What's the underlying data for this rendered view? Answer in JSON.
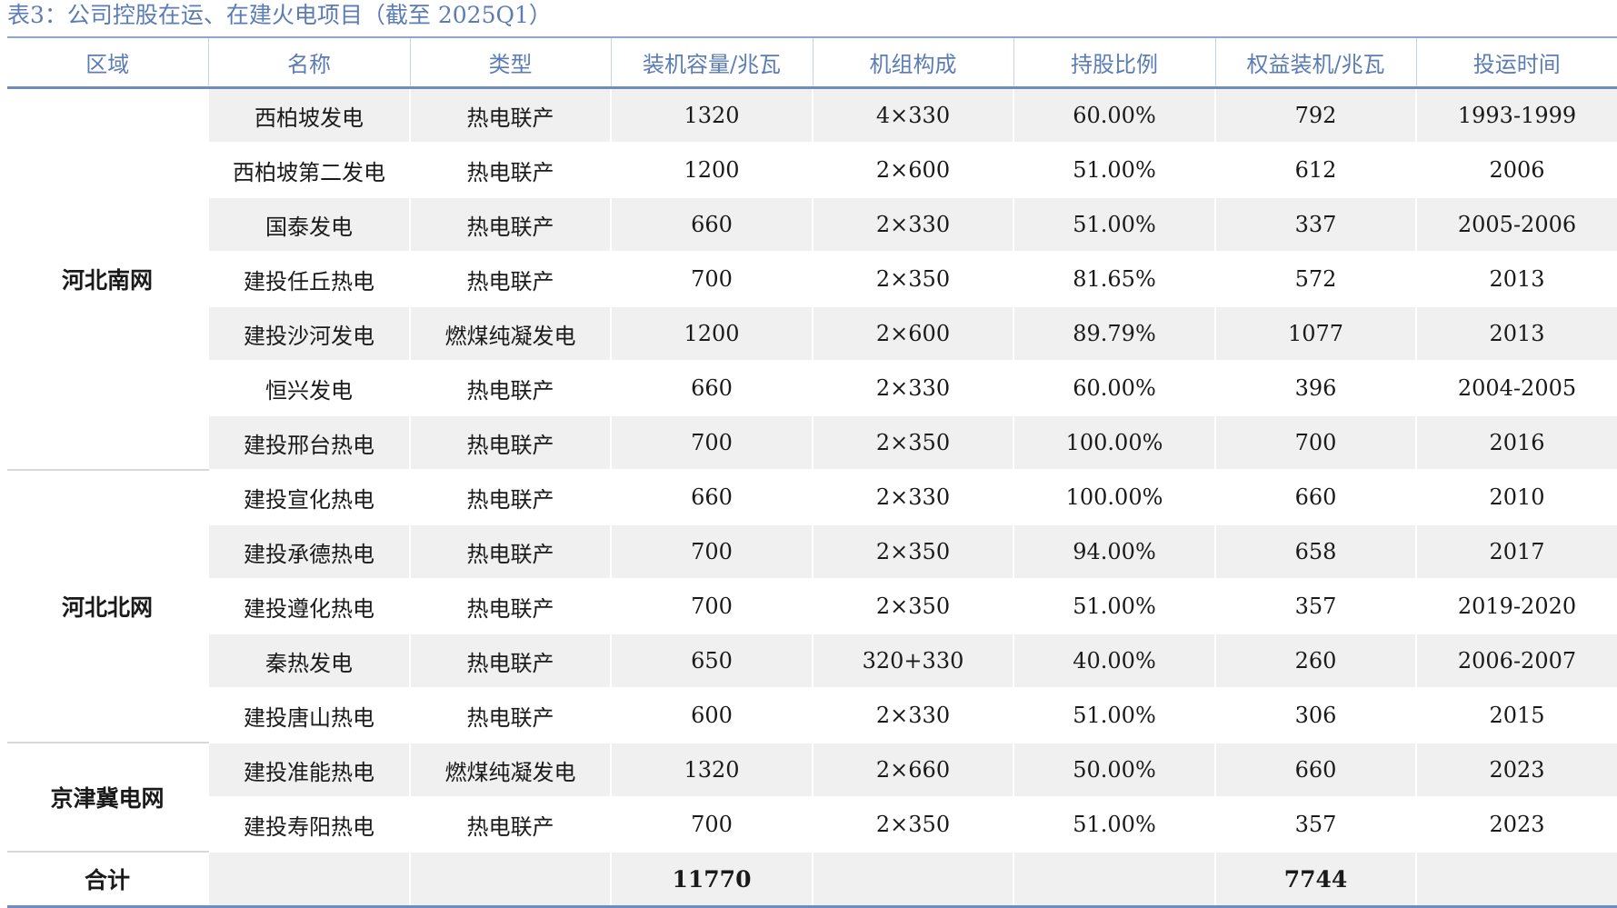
{
  "caption": "表3：公司控股在运、在建火电项目（截至 2025Q1）",
  "headers": [
    "区域",
    "名称",
    "类型",
    "装机容量/兆瓦",
    "机组构成",
    "持股比例",
    "权益装机/兆瓦",
    "投运时间"
  ],
  "regions": [
    {
      "name": "河北南网",
      "rows": [
        [
          "西柏坡发电",
          "热电联产",
          "1320",
          "4×330",
          "60.00%",
          "792",
          "1993-1999"
        ],
        [
          "西柏坡第二发电",
          "热电联产",
          "1200",
          "2×600",
          "51.00%",
          "612",
          "2006"
        ],
        [
          "国泰发电",
          "热电联产",
          "660",
          "2×330",
          "51.00%",
          "337",
          "2005-2006"
        ],
        [
          "建投任丘热电",
          "热电联产",
          "700",
          "2×350",
          "81.65%",
          "572",
          "2013"
        ],
        [
          "建投沙河发电",
          "燃煤纯凝发电",
          "1200",
          "2×600",
          "89.79%",
          "1077",
          "2013"
        ],
        [
          "恒兴发电",
          "热电联产",
          "660",
          "2×330",
          "60.00%",
          "396",
          "2004-2005"
        ],
        [
          "建投邢台热电",
          "热电联产",
          "700",
          "2×350",
          "100.00%",
          "700",
          "2016"
        ]
      ]
    },
    {
      "name": "河北北网",
      "rows": [
        [
          "建投宣化热电",
          "热电联产",
          "660",
          "2×330",
          "100.00%",
          "660",
          "2010"
        ],
        [
          "建投承德热电",
          "热电联产",
          "700",
          "2×350",
          "94.00%",
          "658",
          "2017"
        ],
        [
          "建投遵化热电",
          "热电联产",
          "700",
          "2×350",
          "51.00%",
          "357",
          "2019-2020"
        ],
        [
          "秦热发电",
          "热电联产",
          "650",
          "320+330",
          "40.00%",
          "260",
          "2006-2007"
        ],
        [
          "建投唐山热电",
          "热电联产",
          "600",
          "2×330",
          "51.00%",
          "306",
          "2015"
        ]
      ]
    },
    {
      "name": "京津冀电网",
      "rows": [
        [
          "建投准能热电",
          "燃煤纯凝发电",
          "1320",
          "2×660",
          "50.00%",
          "660",
          "2023"
        ],
        [
          "建投寿阳热电",
          "热电联产",
          "700",
          "2×350",
          "51.00%",
          "357",
          "2023"
        ]
      ]
    }
  ],
  "total": {
    "label": "合计",
    "capacity": "11770",
    "equity_capacity": "7744"
  },
  "colors": {
    "header_text": "#5b7cb5",
    "rule": "#6f8cc0",
    "stripe": "#f0f0f0"
  }
}
